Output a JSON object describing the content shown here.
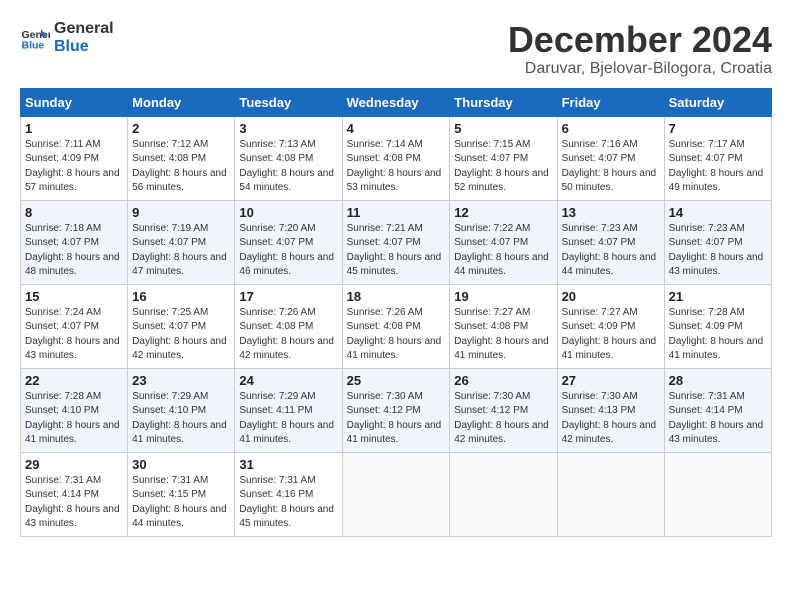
{
  "header": {
    "logo_general": "General",
    "logo_blue": "Blue",
    "month_title": "December 2024",
    "location": "Daruvar, Bjelovar-Bilogora, Croatia"
  },
  "weekdays": [
    "Sunday",
    "Monday",
    "Tuesday",
    "Wednesday",
    "Thursday",
    "Friday",
    "Saturday"
  ],
  "weeks": [
    [
      {
        "day": "1",
        "sunrise": "7:11 AM",
        "sunset": "4:09 PM",
        "daylight": "8 hours and 57 minutes."
      },
      {
        "day": "2",
        "sunrise": "7:12 AM",
        "sunset": "4:08 PM",
        "daylight": "8 hours and 56 minutes."
      },
      {
        "day": "3",
        "sunrise": "7:13 AM",
        "sunset": "4:08 PM",
        "daylight": "8 hours and 54 minutes."
      },
      {
        "day": "4",
        "sunrise": "7:14 AM",
        "sunset": "4:08 PM",
        "daylight": "8 hours and 53 minutes."
      },
      {
        "day": "5",
        "sunrise": "7:15 AM",
        "sunset": "4:07 PM",
        "daylight": "8 hours and 52 minutes."
      },
      {
        "day": "6",
        "sunrise": "7:16 AM",
        "sunset": "4:07 PM",
        "daylight": "8 hours and 50 minutes."
      },
      {
        "day": "7",
        "sunrise": "7:17 AM",
        "sunset": "4:07 PM",
        "daylight": "8 hours and 49 minutes."
      }
    ],
    [
      {
        "day": "8",
        "sunrise": "7:18 AM",
        "sunset": "4:07 PM",
        "daylight": "8 hours and 48 minutes."
      },
      {
        "day": "9",
        "sunrise": "7:19 AM",
        "sunset": "4:07 PM",
        "daylight": "8 hours and 47 minutes."
      },
      {
        "day": "10",
        "sunrise": "7:20 AM",
        "sunset": "4:07 PM",
        "daylight": "8 hours and 46 minutes."
      },
      {
        "day": "11",
        "sunrise": "7:21 AM",
        "sunset": "4:07 PM",
        "daylight": "8 hours and 45 minutes."
      },
      {
        "day": "12",
        "sunrise": "7:22 AM",
        "sunset": "4:07 PM",
        "daylight": "8 hours and 44 minutes."
      },
      {
        "day": "13",
        "sunrise": "7:23 AM",
        "sunset": "4:07 PM",
        "daylight": "8 hours and 44 minutes."
      },
      {
        "day": "14",
        "sunrise": "7:23 AM",
        "sunset": "4:07 PM",
        "daylight": "8 hours and 43 minutes."
      }
    ],
    [
      {
        "day": "15",
        "sunrise": "7:24 AM",
        "sunset": "4:07 PM",
        "daylight": "8 hours and 43 minutes."
      },
      {
        "day": "16",
        "sunrise": "7:25 AM",
        "sunset": "4:07 PM",
        "daylight": "8 hours and 42 minutes."
      },
      {
        "day": "17",
        "sunrise": "7:26 AM",
        "sunset": "4:08 PM",
        "daylight": "8 hours and 42 minutes."
      },
      {
        "day": "18",
        "sunrise": "7:26 AM",
        "sunset": "4:08 PM",
        "daylight": "8 hours and 41 minutes."
      },
      {
        "day": "19",
        "sunrise": "7:27 AM",
        "sunset": "4:08 PM",
        "daylight": "8 hours and 41 minutes."
      },
      {
        "day": "20",
        "sunrise": "7:27 AM",
        "sunset": "4:09 PM",
        "daylight": "8 hours and 41 minutes."
      },
      {
        "day": "21",
        "sunrise": "7:28 AM",
        "sunset": "4:09 PM",
        "daylight": "8 hours and 41 minutes."
      }
    ],
    [
      {
        "day": "22",
        "sunrise": "7:28 AM",
        "sunset": "4:10 PM",
        "daylight": "8 hours and 41 minutes."
      },
      {
        "day": "23",
        "sunrise": "7:29 AM",
        "sunset": "4:10 PM",
        "daylight": "8 hours and 41 minutes."
      },
      {
        "day": "24",
        "sunrise": "7:29 AM",
        "sunset": "4:11 PM",
        "daylight": "8 hours and 41 minutes."
      },
      {
        "day": "25",
        "sunrise": "7:30 AM",
        "sunset": "4:12 PM",
        "daylight": "8 hours and 41 minutes."
      },
      {
        "day": "26",
        "sunrise": "7:30 AM",
        "sunset": "4:12 PM",
        "daylight": "8 hours and 42 minutes."
      },
      {
        "day": "27",
        "sunrise": "7:30 AM",
        "sunset": "4:13 PM",
        "daylight": "8 hours and 42 minutes."
      },
      {
        "day": "28",
        "sunrise": "7:31 AM",
        "sunset": "4:14 PM",
        "daylight": "8 hours and 43 minutes."
      }
    ],
    [
      {
        "day": "29",
        "sunrise": "7:31 AM",
        "sunset": "4:14 PM",
        "daylight": "8 hours and 43 minutes."
      },
      {
        "day": "30",
        "sunrise": "7:31 AM",
        "sunset": "4:15 PM",
        "daylight": "8 hours and 44 minutes."
      },
      {
        "day": "31",
        "sunrise": "7:31 AM",
        "sunset": "4:16 PM",
        "daylight": "8 hours and 45 minutes."
      },
      null,
      null,
      null,
      null
    ]
  ]
}
